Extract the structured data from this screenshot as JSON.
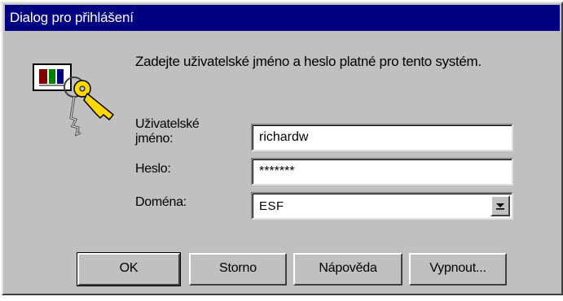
{
  "window": {
    "title": "Dialog pro přihlášení"
  },
  "icon": {
    "name": "keys-with-id-card-icon"
  },
  "instruction": "Zadejte uživatelské jméno a heslo platné pro tento systém.",
  "form": {
    "username_label": "Uživatelské jméno:",
    "username_value": "richardw",
    "password_label": "Heslo:",
    "password_value": "*******",
    "domain_label": "Doména:",
    "domain_value": "ESF"
  },
  "buttons": {
    "ok": "OK",
    "cancel": "Storno",
    "help": "Nápověda",
    "shutdown": "Vypnout..."
  },
  "colors": {
    "titlebar": "#000080",
    "face": "#c0c0c0",
    "field_bg": "#ffffff"
  }
}
